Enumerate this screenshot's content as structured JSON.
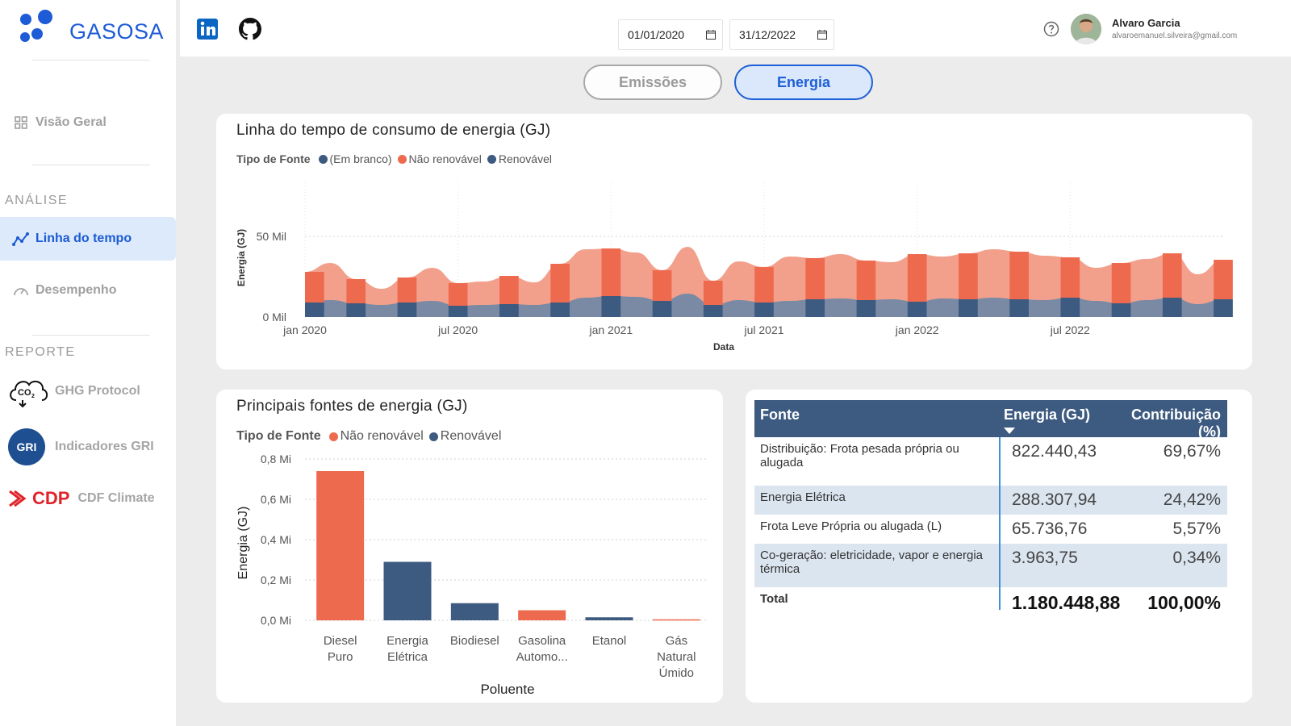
{
  "brand": {
    "name": "GASOSA",
    "colors": {
      "primary": "#1e5bd6",
      "nonrenewable": "#ee6a4e",
      "renewable": "#3d5a80"
    }
  },
  "sidebar": {
    "overview": {
      "label": "Visão Geral",
      "icon": "grid-icon"
    },
    "analysis_heading": "ANÁLISE",
    "analysis_items": [
      {
        "label": "Linha do tempo",
        "icon": "line-chart-icon",
        "active": true
      },
      {
        "label": "Desempenho",
        "icon": "gauge-icon",
        "active": false
      }
    ],
    "report_heading": "REPORTE",
    "report_items": [
      {
        "label": "GHG Protocol",
        "icon": "co2-cloud-icon"
      },
      {
        "label": "Indicadores GRI",
        "icon": "gri-logo",
        "logo_text": "GRI"
      },
      {
        "label": "CDF Climate",
        "icon": "cdp-logo",
        "logo_text": "CDP"
      }
    ]
  },
  "header": {
    "social": [
      {
        "name": "linkedin-icon"
      },
      {
        "name": "github-icon"
      }
    ],
    "date_start": "01/01/2020",
    "date_end": "31/12/2022",
    "user_name": "Alvaro Garcia",
    "user_email": "alvaroemanuel.silveira@gmail.com"
  },
  "tabs": {
    "emissions": "Emissões",
    "energy": "Energia",
    "active": "energy"
  },
  "timeline_card": {
    "title": "Linha do tempo de consumo de energia (GJ)",
    "legend_title": "Tipo de Fonte",
    "legend": [
      {
        "label": "(Em branco)",
        "color": "#3d5a80"
      },
      {
        "label": "Não renovável",
        "color": "#ee6a4e"
      },
      {
        "label": "Renovável",
        "color": "#3d5a80"
      }
    ]
  },
  "sources_card": {
    "title": "Principais fontes de energia (GJ)",
    "legend_title": "Tipo de Fonte",
    "legend": [
      {
        "label": "Não renovável",
        "color": "#ee6a4e"
      },
      {
        "label": "Renovável",
        "color": "#3d5a80"
      }
    ]
  },
  "table": {
    "headers": {
      "source": "Fonte",
      "energy": "Energia (GJ)",
      "share": "Contribuição (%)"
    },
    "rows": [
      {
        "source": "Distribuição: Frota pesada própria ou alugada",
        "energy": "822.440,43",
        "share": "69,67%"
      },
      {
        "source": "Energia Elétrica",
        "energy": "288.307,94",
        "share": "24,42%"
      },
      {
        "source": "Frota Leve Própria ou alugada (L)",
        "energy": "65.736,76",
        "share": "5,57%"
      },
      {
        "source": "Co-geração: eletricidade, vapor e energia térmica",
        "energy": "3.963,75",
        "share": "0,34%"
      }
    ],
    "total": {
      "label": "Total",
      "energy": "1.180.448,88",
      "share": "100,00%"
    }
  },
  "chart_data": [
    {
      "type": "area",
      "title": "Linha do tempo de consumo de energia (GJ)",
      "xlabel": "Data",
      "ylabel": "Energia (GJ)",
      "x_ticks": [
        "jan 2020",
        "jul 2020",
        "jan 2021",
        "jul 2021",
        "jan 2022",
        "jul 2022"
      ],
      "y_ticks": [
        "0 Mil",
        "50 Mil"
      ],
      "ylim": [
        0,
        50000
      ],
      "stacked": true,
      "x": [
        "2020-01",
        "2020-02",
        "2020-03",
        "2020-04",
        "2020-05",
        "2020-06",
        "2020-07",
        "2020-08",
        "2020-09",
        "2020-10",
        "2020-11",
        "2020-12",
        "2021-01",
        "2021-02",
        "2021-03",
        "2021-04",
        "2021-05",
        "2021-06",
        "2021-07",
        "2021-08",
        "2021-09",
        "2021-10",
        "2021-11",
        "2021-12",
        "2022-01",
        "2022-02",
        "2022-03",
        "2022-04",
        "2022-05",
        "2022-06",
        "2022-07",
        "2022-08",
        "2022-09",
        "2022-10",
        "2022-11",
        "2022-12"
      ],
      "series": [
        {
          "name": "Renovável",
          "color": "#3d5a80",
          "values": [
            9000,
            10500,
            8500,
            7500,
            9000,
            10000,
            7000,
            7500,
            8000,
            7500,
            9000,
            12000,
            13000,
            12500,
            10000,
            14500,
            7500,
            10500,
            9000,
            10000,
            11000,
            11500,
            10500,
            11000,
            9500,
            11500,
            11000,
            12000,
            11000,
            10500,
            12000,
            10000,
            8500,
            10500,
            12000,
            8000,
            11000
          ]
        },
        {
          "name": "Não renovável",
          "color": "#ee6a4e",
          "values": [
            19000,
            23000,
            15000,
            10000,
            15500,
            20500,
            14000,
            14500,
            17500,
            14000,
            24000,
            30000,
            29500,
            27500,
            19000,
            29000,
            15000,
            24000,
            22000,
            27500,
            25500,
            27500,
            24500,
            23000,
            29500,
            26000,
            28500,
            30000,
            29500,
            27500,
            25000,
            20500,
            25000,
            25500,
            27500,
            18500,
            24500
          ]
        }
      ]
    },
    {
      "type": "bar",
      "title": "Principais fontes de energia (GJ)",
      "xlabel": "Poluente",
      "ylabel": "Energia (GJ)",
      "y_ticks": [
        "0,0 Mi",
        "0,2 Mi",
        "0,4 Mi",
        "0,6 Mi",
        "0,8 Mi"
      ],
      "ylim": [
        0,
        0.8
      ],
      "categories": [
        "Diesel Puro",
        "Energia Elétrica",
        "Biodiesel",
        "Gasolina Automo...",
        "Etanol",
        "Gás Natural Úmido"
      ],
      "category_lines": [
        [
          "Diesel",
          "Puro"
        ],
        [
          "Energia",
          "Elétrica"
        ],
        [
          "Biodiesel"
        ],
        [
          "Gasolina",
          "Automo..."
        ],
        [
          "Etanol"
        ],
        [
          "Gás",
          "Natural",
          "Úmido"
        ]
      ],
      "values": [
        0.74,
        0.29,
        0.085,
        0.05,
        0.015,
        0.005
      ],
      "colors": [
        "#ee6a4e",
        "#3d5a80",
        "#3d5a80",
        "#ee6a4e",
        "#3d5a80",
        "#ee6a4e"
      ]
    }
  ]
}
